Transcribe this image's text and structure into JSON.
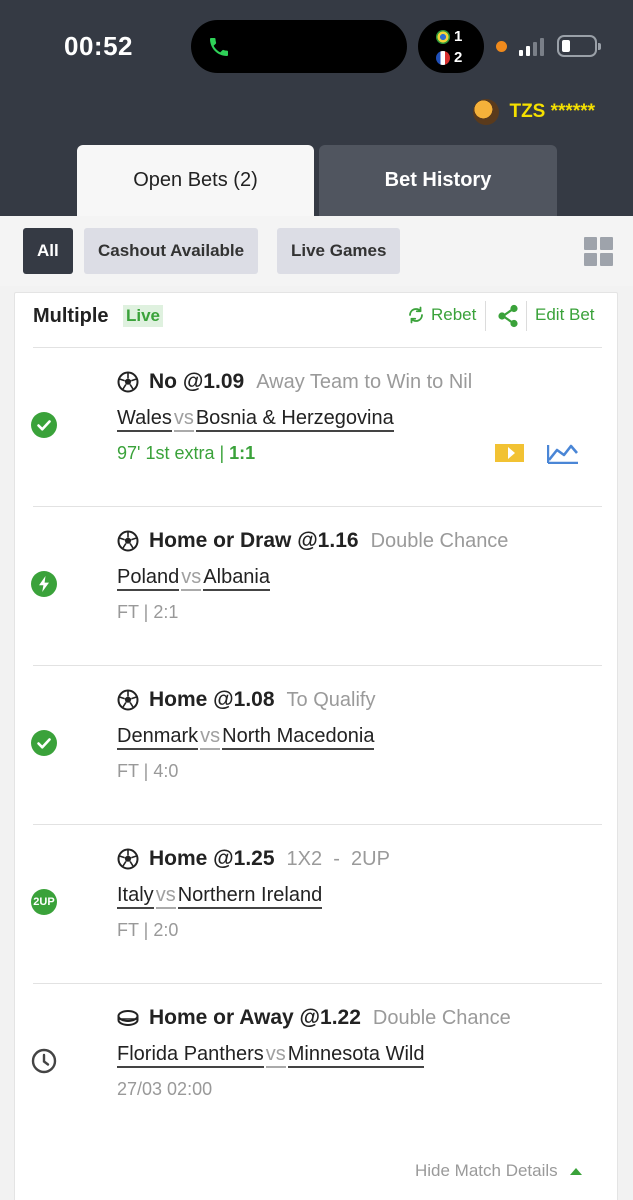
{
  "status_bar": {
    "time": "00:52",
    "score_top": "1",
    "score_bottom": "2"
  },
  "account": {
    "currency_label": "TZS ******"
  },
  "tabs": {
    "open_bets": "Open Bets (2)",
    "bet_history": "Bet History"
  },
  "filters": {
    "all": "All",
    "cashout": "Cashout Available",
    "live_games": "Live Games"
  },
  "bet": {
    "type_label": "Multiple",
    "live_label": "Live",
    "rebet_label": "Rebet",
    "edit_label": "Edit Bet",
    "selections": [
      {
        "status": "won",
        "sport": "football",
        "pick": "No @1.09",
        "market": "Away Team to Win to Nil",
        "home": "Wales",
        "vs": "vs",
        "away": "Bosnia & Herzegovina",
        "info_prefix": "97' 1st extra | ",
        "info_score": "1:1",
        "is_live": true
      },
      {
        "status": "early-payout",
        "sport": "football",
        "pick": "Home or Draw @1.16",
        "market": "Double Chance",
        "home": "Poland",
        "vs": "vs",
        "away": "Albania",
        "info": "FT | 2:1"
      },
      {
        "status": "won",
        "sport": "football",
        "pick": "Home @1.08",
        "market": "To Qualify",
        "home": "Denmark",
        "vs": "vs",
        "away": "North Macedonia",
        "info": "FT | 4:0"
      },
      {
        "status": "2up",
        "status_text": "2UP",
        "sport": "football",
        "pick": "Home @1.25",
        "market": "1X2  -  2UP",
        "home": "Italy",
        "vs": "vs",
        "away": "Northern Ireland",
        "info": "FT | 2:0"
      },
      {
        "status": "pending",
        "sport": "ice-hockey",
        "pick": "Home or Away @1.22",
        "market": "Double Chance",
        "home": "Florida Panthers",
        "vs": "vs",
        "away": "Minnesota Wild",
        "info": "27/03 02:00"
      }
    ],
    "hide_details_label": "Hide Match Details"
  },
  "colors": {
    "header_bg": "#353a44",
    "accent_green": "#3aa23a",
    "currency_yellow": "#f5e000"
  }
}
